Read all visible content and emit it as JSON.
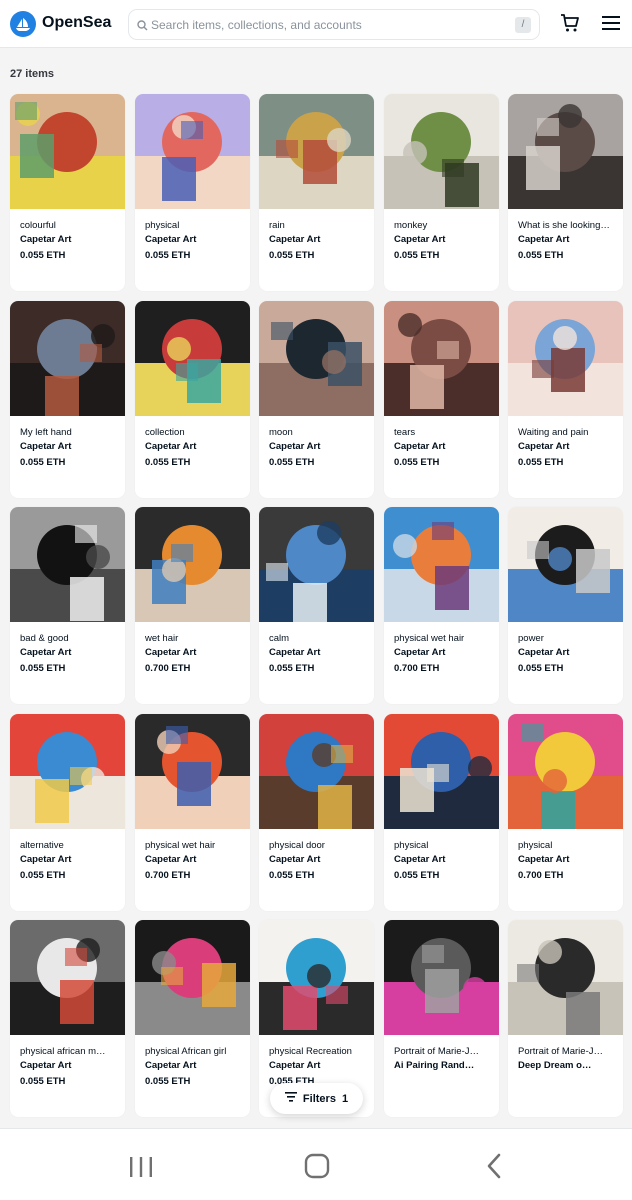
{
  "header": {
    "brand": "OpenSea",
    "search_placeholder": "Search items, collections, and accounts",
    "search_shortcut": "/"
  },
  "results": {
    "count": "27 items"
  },
  "items": [
    {
      "name": "colourful",
      "collection": "Capetar Art",
      "price": "0.055 ETH",
      "palette": [
        "#d9b48f",
        "#c2452d",
        "#5e9e6a",
        "#e8d24a"
      ]
    },
    {
      "name": "physical",
      "collection": "Capetar Art",
      "price": "0.055 ETH",
      "palette": [
        "#b9aee6",
        "#e2685f",
        "#4a5fb5",
        "#f2d7c5"
      ]
    },
    {
      "name": "rain",
      "collection": "Capetar Art",
      "price": "0.055 ETH",
      "palette": [
        "#7e8f86",
        "#c9a24a",
        "#b44c3a",
        "#dcd6c3"
      ]
    },
    {
      "name": "monkey",
      "collection": "Capetar Art",
      "price": "0.055 ETH",
      "palette": [
        "#e9e6df",
        "#6f8f46",
        "#2f3a22",
        "#c7c2b8"
      ]
    },
    {
      "name": "What is she looking…",
      "collection": "Capetar Art",
      "price": "0.055 ETH",
      "palette": [
        "#a8a3a0",
        "#5b4b46",
        "#d8d2cd",
        "#3a3433"
      ]
    },
    {
      "name": "My left hand",
      "collection": "Capetar Art",
      "price": "0.055 ETH",
      "palette": [
        "#3c2b26",
        "#6d7c93",
        "#b35a3f",
        "#1e1a19"
      ]
    },
    {
      "name": "collection",
      "collection": "Capetar Art",
      "price": "0.055 ETH",
      "palette": [
        "#1f1f1f",
        "#c83b3b",
        "#3aa6a0",
        "#e8d35a"
      ]
    },
    {
      "name": "moon",
      "collection": "Capetar Art",
      "price": "0.055 ETH",
      "palette": [
        "#c9a99a",
        "#1d2730",
        "#3b5166",
        "#8e6e62"
      ]
    },
    {
      "name": "tears",
      "collection": "Capetar Art",
      "price": "0.055 ETH",
      "palette": [
        "#c98f80",
        "#7a4c43",
        "#e0b7a6",
        "#4b2d29"
      ]
    },
    {
      "name": "Waiting and pain",
      "collection": "Capetar Art",
      "price": "0.055 ETH",
      "palette": [
        "#e7c3bb",
        "#7aa5d6",
        "#7a3b36",
        "#f2e3dc"
      ]
    },
    {
      "name": "bad & good",
      "collection": "Capetar Art",
      "price": "0.055 ETH",
      "palette": [
        "#9a9a9a",
        "#121212",
        "#f0f0f0",
        "#4a4a4a"
      ]
    },
    {
      "name": "wet hair",
      "collection": "Capetar Art",
      "price": "0.700 ETH",
      "palette": [
        "#2b2b2b",
        "#e58a2f",
        "#3f7fc0",
        "#d8c7b4"
      ]
    },
    {
      "name": "calm",
      "collection": "Capetar Art",
      "price": "0.055 ETH",
      "palette": [
        "#3a3a3a",
        "#4f88c7",
        "#e6eef5",
        "#1d3d62"
      ]
    },
    {
      "name": "physical wet hair",
      "collection": "Capetar Art",
      "price": "0.700 ETH",
      "palette": [
        "#3f8fd0",
        "#e97d3b",
        "#6c3b7a",
        "#c9d8e6"
      ]
    },
    {
      "name": "power",
      "collection": "Capetar Art",
      "price": "0.055 ETH",
      "palette": [
        "#f1ece6",
        "#1c1c1c",
        "#c9c9c9",
        "#4f86c6"
      ]
    },
    {
      "name": "alternative",
      "collection": "Capetar Art",
      "price": "0.055 ETH",
      "palette": [
        "#e3453b",
        "#3a8bd1",
        "#f1c94a",
        "#ede6dc"
      ]
    },
    {
      "name": "physical wet hair",
      "collection": "Capetar Art",
      "price": "0.700 ETH",
      "palette": [
        "#2a2a2a",
        "#e3542f",
        "#3d5fb0",
        "#f0d0b8"
      ]
    },
    {
      "name": "physical door",
      "collection": "Capetar Art",
      "price": "0.055 ETH",
      "palette": [
        "#d2413b",
        "#2f78c4",
        "#e0b347",
        "#5a3c2c"
      ]
    },
    {
      "name": "physical",
      "collection": "Capetar Art",
      "price": "0.055 ETH",
      "palette": [
        "#e24a36",
        "#2e5fa8",
        "#ede4d4",
        "#1f2a3f"
      ]
    },
    {
      "name": "physical",
      "collection": "Capetar Art",
      "price": "0.700 ETH",
      "palette": [
        "#e14d8a",
        "#f1c93b",
        "#2aa6a0",
        "#e3643a"
      ]
    },
    {
      "name": "physical african m…",
      "collection": "Capetar Art",
      "price": "0.055 ETH",
      "palette": [
        "#6b6b6b",
        "#e8e8e8",
        "#d24a3a",
        "#1e1e1e"
      ]
    },
    {
      "name": "physical African girl",
      "collection": "Capetar Art",
      "price": "0.055 ETH",
      "palette": [
        "#1a1a1a",
        "#d93e7a",
        "#e6a83b",
        "#8a8a8a"
      ]
    },
    {
      "name": "physical Recreation",
      "collection": "Capetar Art",
      "price": "0.055 ETH",
      "palette": [
        "#f4f2ef",
        "#2f9fd0",
        "#e24b6e",
        "#2a2a2a"
      ]
    },
    {
      "name": "Portrait of Marie-J…",
      "collection": "Ai Pairing Rand…",
      "price": "",
      "palette": [
        "#1b1b1b",
        "#5a5a5a",
        "#a0a0a0",
        "#d63fa0"
      ]
    },
    {
      "name": "Portrait of Marie-J…",
      "collection": "Deep Dream o…",
      "price": "",
      "palette": [
        "#ece9e2",
        "#2a2a2a",
        "#7a7a7a",
        "#c8c3b8"
      ]
    }
  ],
  "filters": {
    "label": "Filters",
    "count": "1"
  }
}
